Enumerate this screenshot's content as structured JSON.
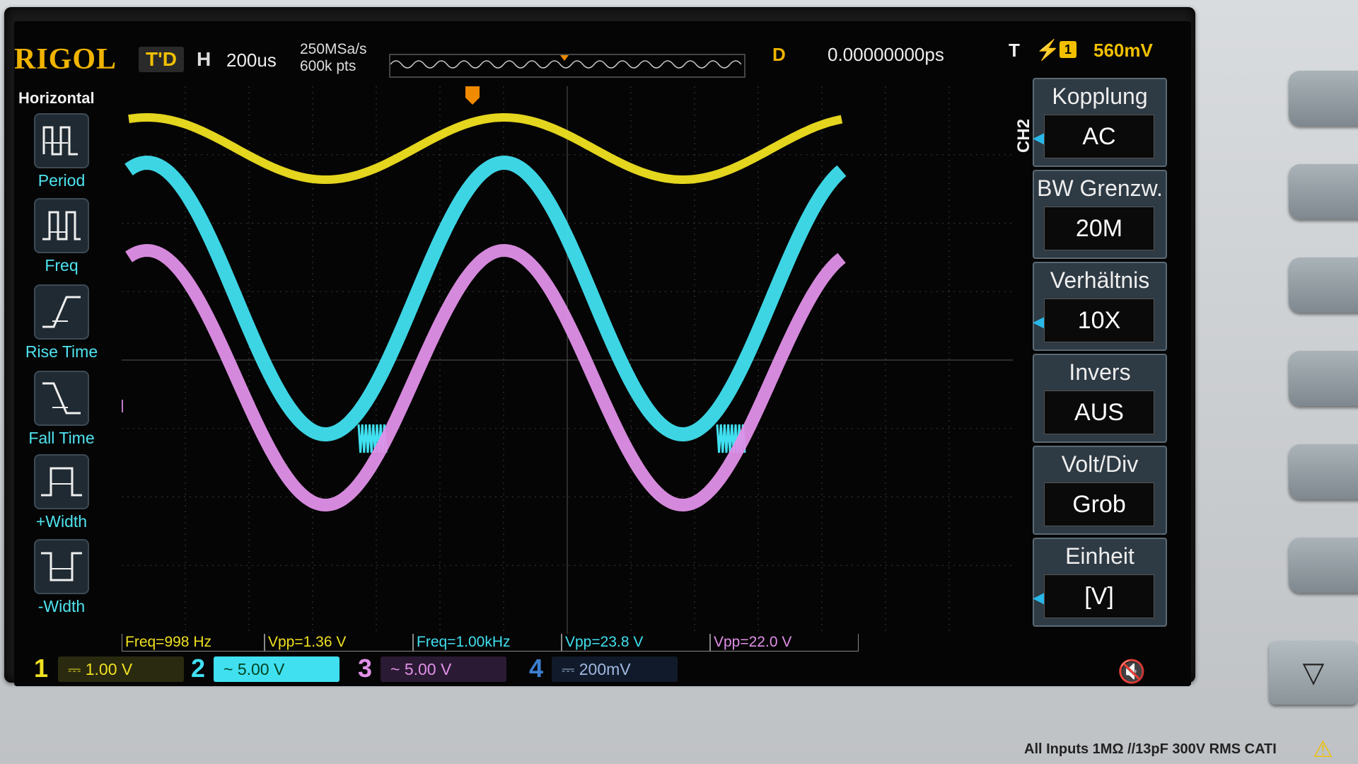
{
  "topbar": {
    "brand": "RIGOL",
    "run_state": "T'D",
    "horizontal_label": "H",
    "timebase": "200us",
    "sample_rate": "250MSa/s",
    "memory_depth": "600k pts",
    "delay_label": "D",
    "delay_value": "0.00000000ps",
    "trigger_label": "T",
    "trigger_source": "1",
    "trigger_level": "560mV"
  },
  "left_panel": {
    "title": "Horizontal",
    "items": [
      {
        "label": "Period",
        "icon": "period-icon"
      },
      {
        "label": "Freq",
        "icon": "frequency-icon"
      },
      {
        "label": "Rise Time",
        "icon": "rise-time-icon"
      },
      {
        "label": "Fall Time",
        "icon": "fall-time-icon"
      },
      {
        "label": "+Width",
        "icon": "positive-width-icon"
      },
      {
        "label": "-Width",
        "icon": "negative-width-icon"
      }
    ]
  },
  "right_menu": {
    "channel_tag": "CH2",
    "items": [
      {
        "title": "Kopplung",
        "value": "AC"
      },
      {
        "title": "BW Grenzw.",
        "value": "20M"
      },
      {
        "title": "Verhältnis",
        "value": "10X"
      },
      {
        "title": "Invers",
        "value": "AUS"
      },
      {
        "title": "Volt/Div",
        "value": "Grob"
      },
      {
        "title": "Einheit",
        "value": "[V]"
      }
    ]
  },
  "measurements": [
    {
      "text": "Freq=998 Hz",
      "color": "#f0e020"
    },
    {
      "text": "Vpp=1.36 V",
      "color": "#f0e020"
    },
    {
      "text": "Freq=1.00kHz",
      "color": "#40e0f0"
    },
    {
      "text": "Vpp=23.8 V",
      "color": "#40e0f0"
    },
    {
      "text": "Vpp=22.0 V",
      "color": "#e090e8"
    }
  ],
  "channels": [
    {
      "number": "1",
      "scale": "1.00 V",
      "coupling": "DC",
      "color": "#f0e020"
    },
    {
      "number": "2",
      "scale": "5.00 V",
      "coupling": "AC",
      "color": "#40e0f0"
    },
    {
      "number": "3",
      "scale": "5.00 V",
      "coupling": "AC",
      "color": "#e090e8"
    },
    {
      "number": "4",
      "scale": "200mV",
      "coupling": "DC",
      "color": "#3c7fd0"
    }
  ],
  "channel_markers": [
    "1",
    "2",
    "3"
  ],
  "footer": {
    "input_spec": "All Inputs 1MΩ //13pF 300V RMS    CATI"
  },
  "colors": {
    "ch1": "#f0e020",
    "ch2": "#40e0f0",
    "ch3": "#e090e8",
    "ch4": "#3c7fd0",
    "brand": "#f0b400",
    "menu_bg": "#2e3a44"
  },
  "icons": {
    "trigger_edge": "rising-edge-icon",
    "mute": "speaker-mute-icon",
    "warning": "warning-triangle-icon",
    "page_down": "chevron-down-icon"
  }
}
